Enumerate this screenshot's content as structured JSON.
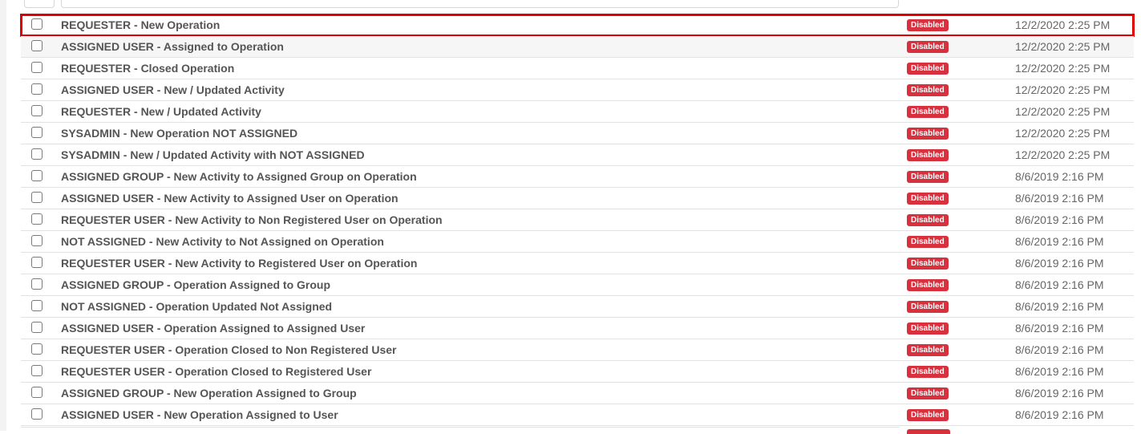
{
  "status_badge_color": "#d9303e",
  "selection_outline_color": "#e00000",
  "rows": [
    {
      "name": "REQUESTER - New Operation",
      "status": "Disabled",
      "date": "12/2/2020 2:25 PM"
    },
    {
      "name": "ASSIGNED USER - Assigned to Operation",
      "status": "Disabled",
      "date": "12/2/2020 2:25 PM"
    },
    {
      "name": "REQUESTER - Closed Operation",
      "status": "Disabled",
      "date": "12/2/2020 2:25 PM"
    },
    {
      "name": "ASSIGNED USER - New / Updated Activity",
      "status": "Disabled",
      "date": "12/2/2020 2:25 PM"
    },
    {
      "name": "REQUESTER - New / Updated Activity",
      "status": "Disabled",
      "date": "12/2/2020 2:25 PM"
    },
    {
      "name": "SYSADMIN - New Operation NOT ASSIGNED",
      "status": "Disabled",
      "date": "12/2/2020 2:25 PM"
    },
    {
      "name": "SYSADMIN - New / Updated Activity with NOT ASSIGNED",
      "status": "Disabled",
      "date": "12/2/2020 2:25 PM"
    },
    {
      "name": "ASSIGNED GROUP - New Activity to Assigned Group on Operation",
      "status": "Disabled",
      "date": "8/6/2019 2:16 PM"
    },
    {
      "name": "ASSIGNED USER - New Activity to Assigned User on Operation",
      "status": "Disabled",
      "date": "8/6/2019 2:16 PM"
    },
    {
      "name": "REQUESTER USER - New Activity to Non Registered User on Operation",
      "status": "Disabled",
      "date": "8/6/2019 2:16 PM"
    },
    {
      "name": "NOT ASSIGNED - New Activity to Not Assigned on Operation",
      "status": "Disabled",
      "date": "8/6/2019 2:16 PM"
    },
    {
      "name": "REQUESTER USER - New Activity to Registered User on Operation",
      "status": "Disabled",
      "date": "8/6/2019 2:16 PM"
    },
    {
      "name": "ASSIGNED GROUP - Operation Assigned to Group",
      "status": "Disabled",
      "date": "8/6/2019 2:16 PM"
    },
    {
      "name": "NOT ASSIGNED - Operation Updated Not Assigned",
      "status": "Disabled",
      "date": "8/6/2019 2:16 PM"
    },
    {
      "name": "ASSIGNED USER - Operation Assigned to Assigned User",
      "status": "Disabled",
      "date": "8/6/2019 2:16 PM"
    },
    {
      "name": "REQUESTER USER - Operation Closed to Non Registered User",
      "status": "Disabled",
      "date": "8/6/2019 2:16 PM"
    },
    {
      "name": "REQUESTER USER - Operation Closed to Registered User",
      "status": "Disabled",
      "date": "8/6/2019 2:16 PM"
    },
    {
      "name": "ASSIGNED GROUP - New Operation Assigned to Group",
      "status": "Disabled",
      "date": "8/6/2019 2:16 PM"
    },
    {
      "name": "ASSIGNED USER - New Operation Assigned to User",
      "status": "Disabled",
      "date": "8/6/2019 2:16 PM"
    }
  ]
}
